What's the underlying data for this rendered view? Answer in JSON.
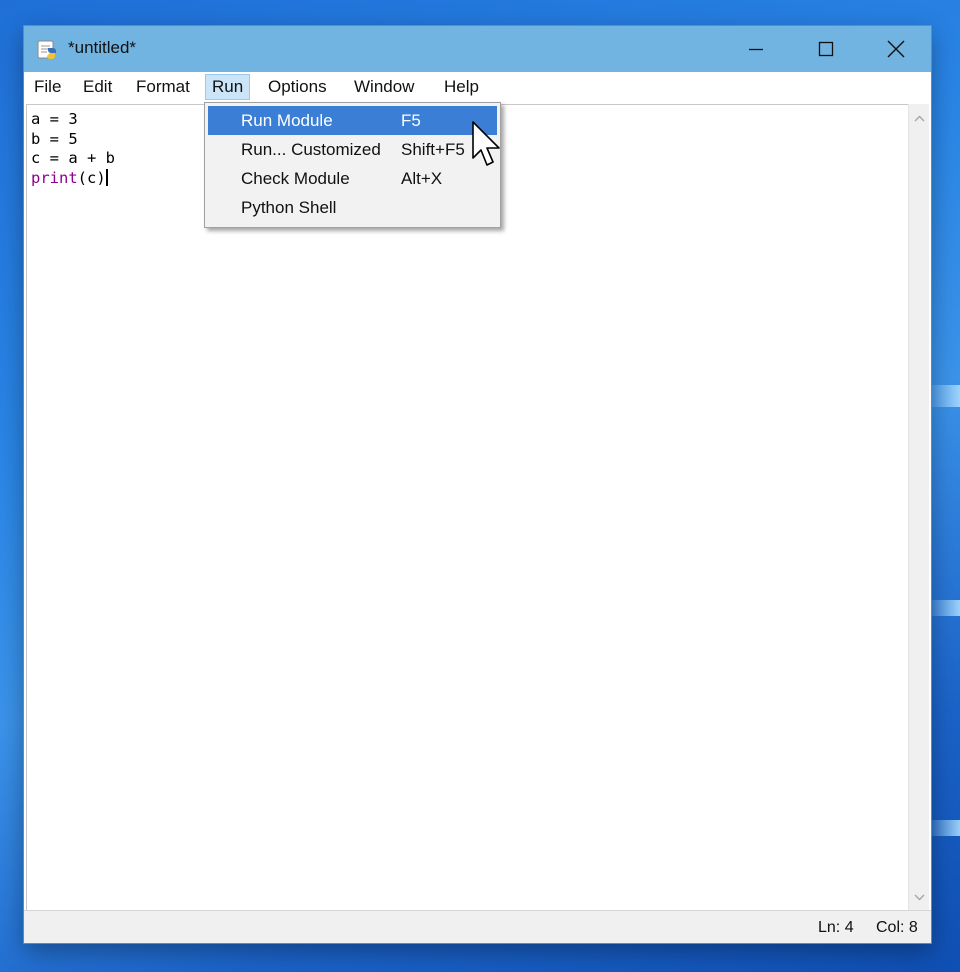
{
  "window": {
    "title": "*untitled*",
    "controls": {
      "minimize": "—",
      "maximize": "☐",
      "close": "✕"
    }
  },
  "menubar": {
    "items": [
      {
        "label": "File"
      },
      {
        "label": "Edit"
      },
      {
        "label": "Format"
      },
      {
        "label": "Run"
      },
      {
        "label": "Options"
      },
      {
        "label": "Window"
      },
      {
        "label": "Help"
      }
    ],
    "active": "Run"
  },
  "editor": {
    "lines": [
      "a = 3",
      "b = 5",
      "c = a + b"
    ],
    "last_line_keyword": "print",
    "last_line_rest": "(c)"
  },
  "run_menu": {
    "items": [
      {
        "label": "Run Module",
        "accelerator": "F5"
      },
      {
        "label": "Run... Customized",
        "accelerator": "Shift+F5"
      },
      {
        "label": "Check Module",
        "accelerator": "Alt+X"
      },
      {
        "label": "Python Shell",
        "accelerator": ""
      }
    ],
    "highlighted": "Run Module"
  },
  "statusbar": {
    "line": "Ln: 4",
    "column": "Col: 8"
  },
  "colors": {
    "titlebar": "#71b4e1",
    "menu_highlight": "#3a7fd5",
    "keyword": "#900090",
    "desktop": "#2a86e6"
  },
  "icons": {
    "app": "idle-python-icon",
    "scroll_up": "chevron-up-icon",
    "scroll_down": "chevron-down-icon",
    "pointer": "mouse-pointer-icon"
  }
}
